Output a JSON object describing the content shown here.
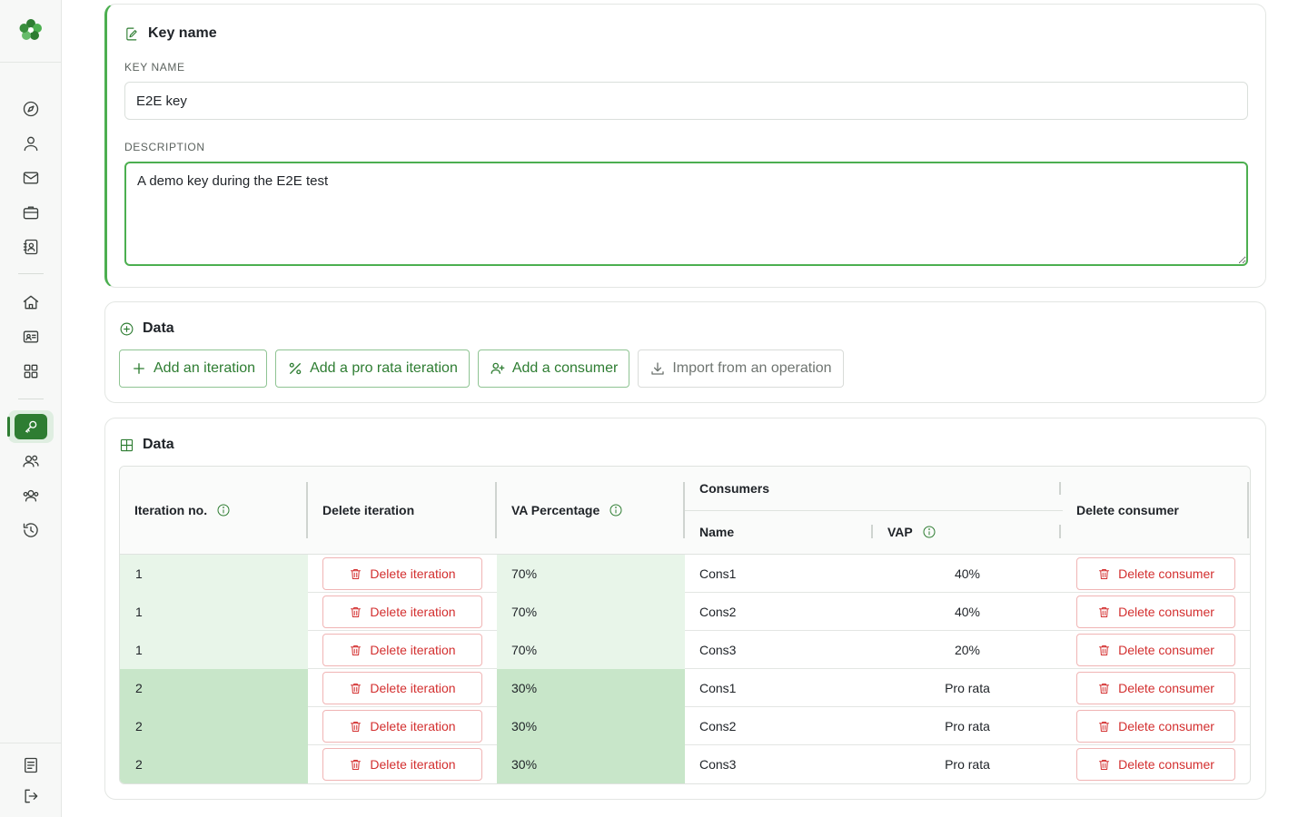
{
  "colors": {
    "accent": "#2e7d32",
    "danger": "#d32f2f",
    "iteration_1_bg": "#e8f5e9",
    "iteration_2_bg": "#c8e6c9"
  },
  "sidebar": {
    "logo": "clover-logo",
    "items": [
      "compass-icon",
      "user-icon",
      "mail-icon",
      "briefcase-icon",
      "contact-card-icon",
      "home-icon",
      "id-card-icon",
      "grid-icon",
      "key-icon",
      "users-icon",
      "group-icon",
      "history-icon"
    ],
    "active": "key-icon",
    "bottom": [
      "document-icon",
      "logout-icon"
    ]
  },
  "key_card": {
    "title": "Key name",
    "key_name_label": "KEY NAME",
    "key_name_value": "E2E key",
    "description_label": "DESCRIPTION",
    "description_value": "A demo key during the E2E test"
  },
  "actions_card": {
    "title": "Data",
    "buttons": {
      "add_iteration": "Add an iteration",
      "add_pro_rata": "Add a pro rata iteration",
      "add_consumer": "Add a consumer",
      "import_operation": "Import from an operation"
    }
  },
  "table_card": {
    "title": "Data",
    "headers": {
      "iteration_no": "Iteration no.",
      "delete_iteration": "Delete iteration",
      "va_percentage": "VA Percentage",
      "consumers": "Consumers",
      "name": "Name",
      "vap": "VAP",
      "delete_consumer": "Delete consumer"
    },
    "delete_iteration_label": "Delete iteration",
    "delete_consumer_label": "Delete consumer",
    "rows": [
      {
        "iteration": "1",
        "va": "70%",
        "name": "Cons1",
        "vap": "40%"
      },
      {
        "iteration": "1",
        "va": "70%",
        "name": "Cons2",
        "vap": "40%"
      },
      {
        "iteration": "1",
        "va": "70%",
        "name": "Cons3",
        "vap": "20%"
      },
      {
        "iteration": "2",
        "va": "30%",
        "name": "Cons1",
        "vap": "Pro rata"
      },
      {
        "iteration": "2",
        "va": "30%",
        "name": "Cons2",
        "vap": "Pro rata"
      },
      {
        "iteration": "2",
        "va": "30%",
        "name": "Cons3",
        "vap": "Pro rata"
      }
    ]
  }
}
